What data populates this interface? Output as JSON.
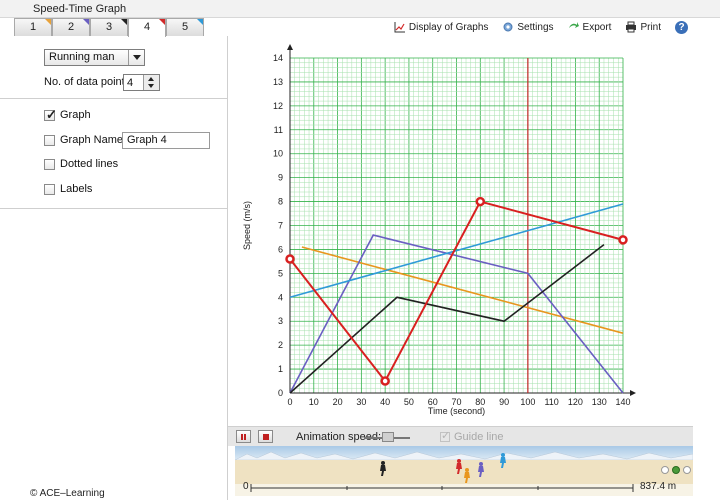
{
  "window": {
    "title": "Speed-Time Graph"
  },
  "tabs": [
    {
      "label": "1",
      "active": false,
      "corner_color": "#e8a23a"
    },
    {
      "label": "2",
      "active": false,
      "corner_color": "#6a5fc2"
    },
    {
      "label": "3",
      "active": false,
      "corner_color": "#222222"
    },
    {
      "label": "4",
      "active": true,
      "corner_color": "#d22a2a"
    },
    {
      "label": "5",
      "active": false,
      "corner_color": "#2f9ad8"
    }
  ],
  "toolbar": {
    "display_graphs": "Display of Graphs",
    "settings": "Settings",
    "export": "Export",
    "print": "Print",
    "help": "?"
  },
  "panel": {
    "subject_select": "Running man",
    "data_points_label": "No. of data point:",
    "data_points_value": "4",
    "graph_label": "Graph",
    "graph_checked": true,
    "graph_name_label": "Graph Name:",
    "graph_name_value": "Graph 4",
    "dotted_label": "Dotted lines",
    "labels_label": "Labels"
  },
  "copyright": "© ACE–Learning",
  "chart_data": {
    "type": "line",
    "xlabel": "Time (second)",
    "ylabel": "Speed (m/s)",
    "xlim": [
      0,
      140
    ],
    "ylim": [
      0,
      14
    ],
    "x_ticks": [
      0,
      10,
      20,
      30,
      40,
      50,
      60,
      70,
      80,
      90,
      100,
      110,
      120,
      130,
      140
    ],
    "y_ticks": [
      0,
      1,
      2,
      3,
      4,
      5,
      6,
      7,
      8,
      9,
      10,
      11,
      12,
      13,
      14
    ],
    "grid": true,
    "marker_x": 100,
    "series": [
      {
        "color": "#e8961e",
        "points": [
          [
            5,
            6.1
          ],
          [
            140,
            2.5
          ]
        ]
      },
      {
        "color": "#6a5fc2",
        "points": [
          [
            0,
            0
          ],
          [
            35,
            6.6
          ],
          [
            100,
            5.0
          ],
          [
            140,
            0
          ]
        ]
      },
      {
        "color": "#222222",
        "points": [
          [
            0,
            0
          ],
          [
            45,
            4.0
          ],
          [
            90,
            3.0
          ],
          [
            132,
            6.2
          ]
        ]
      },
      {
        "color": "#2f9ad8",
        "points": [
          [
            0,
            4.0
          ],
          [
            140,
            7.9
          ]
        ]
      },
      {
        "color": "#d92020",
        "markers": true,
        "points": [
          [
            0,
            5.6
          ],
          [
            40,
            0.5
          ],
          [
            80,
            8.0
          ],
          [
            140,
            6.4
          ]
        ]
      }
    ]
  },
  "animation": {
    "label": "Animation speed:",
    "guide_label": "Guide line",
    "guide_checked": true,
    "scale_start": "0",
    "scale_end": "837.4 m"
  }
}
